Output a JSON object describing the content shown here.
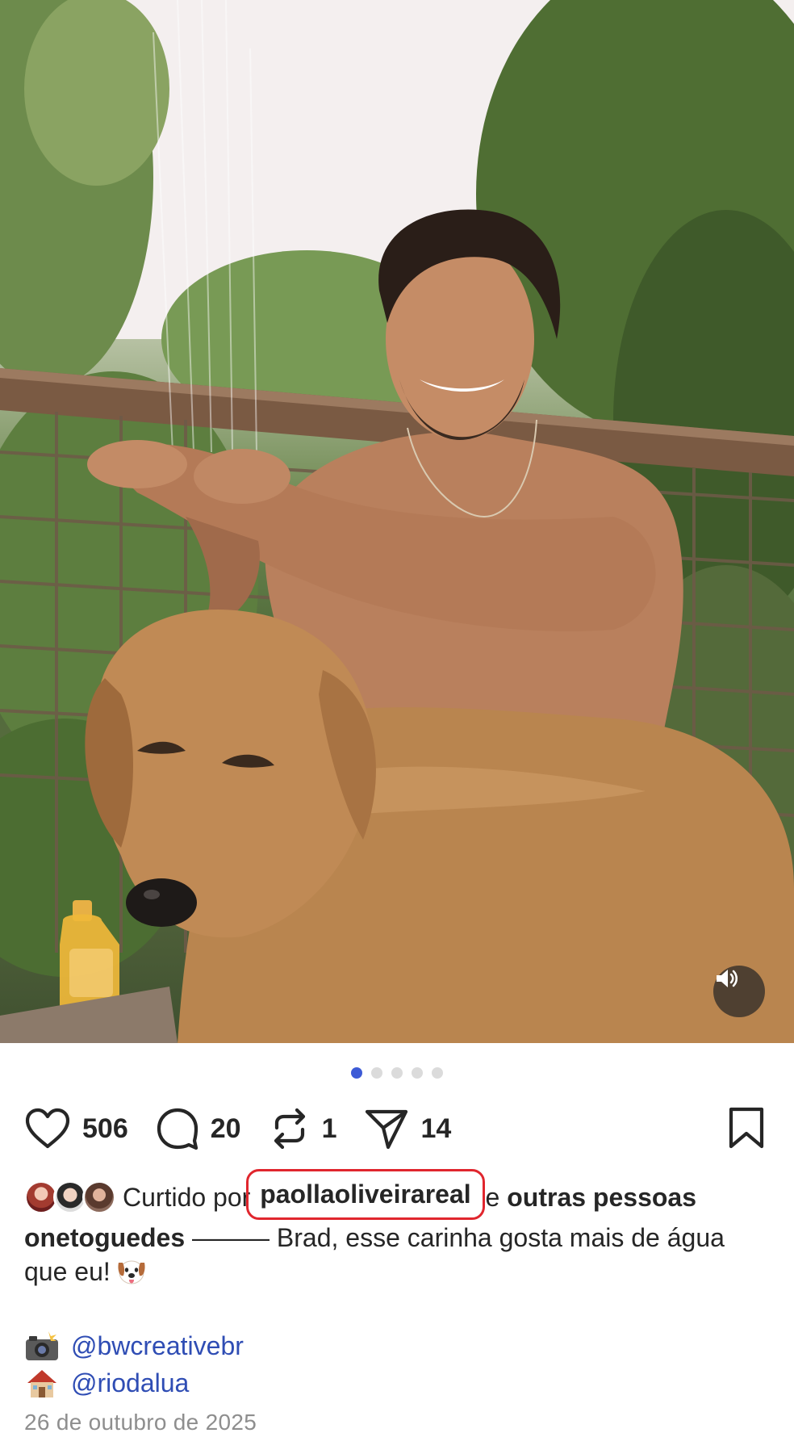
{
  "post": {
    "likes_count": "506",
    "comments_count": "20",
    "reposts_count": "1",
    "shares_count": "14",
    "carousel": {
      "total": 5,
      "active_index": 0
    },
    "liked_by": {
      "prefix": "Curtido por",
      "username": "paollaoliveirareal",
      "conjunction": "e",
      "others": "outras pessoas"
    },
    "caption": {
      "username": "onetoguedes",
      "text": " ——— Brad, esse carinha gosta mais de água que eu!"
    },
    "credits": [
      {
        "icon": "camera-flash-emoji",
        "mention": "@bwcreativebr"
      },
      {
        "icon": "house-emoji",
        "mention": "@riodalua"
      }
    ],
    "date": "26 de outubro de 2025"
  },
  "icons": {
    "like": "heart-icon",
    "comment": "comment-bubble-icon",
    "repost": "repost-icon",
    "share": "paper-plane-icon",
    "save": "bookmark-icon",
    "sound": "speaker-icon",
    "caption_emoji": "dog-face-emoji"
  },
  "colors": {
    "dot_active": "#3d5bd6",
    "mention": "#2f4db4",
    "highlight_box": "#e0262e",
    "date": "#8e8e8e"
  }
}
